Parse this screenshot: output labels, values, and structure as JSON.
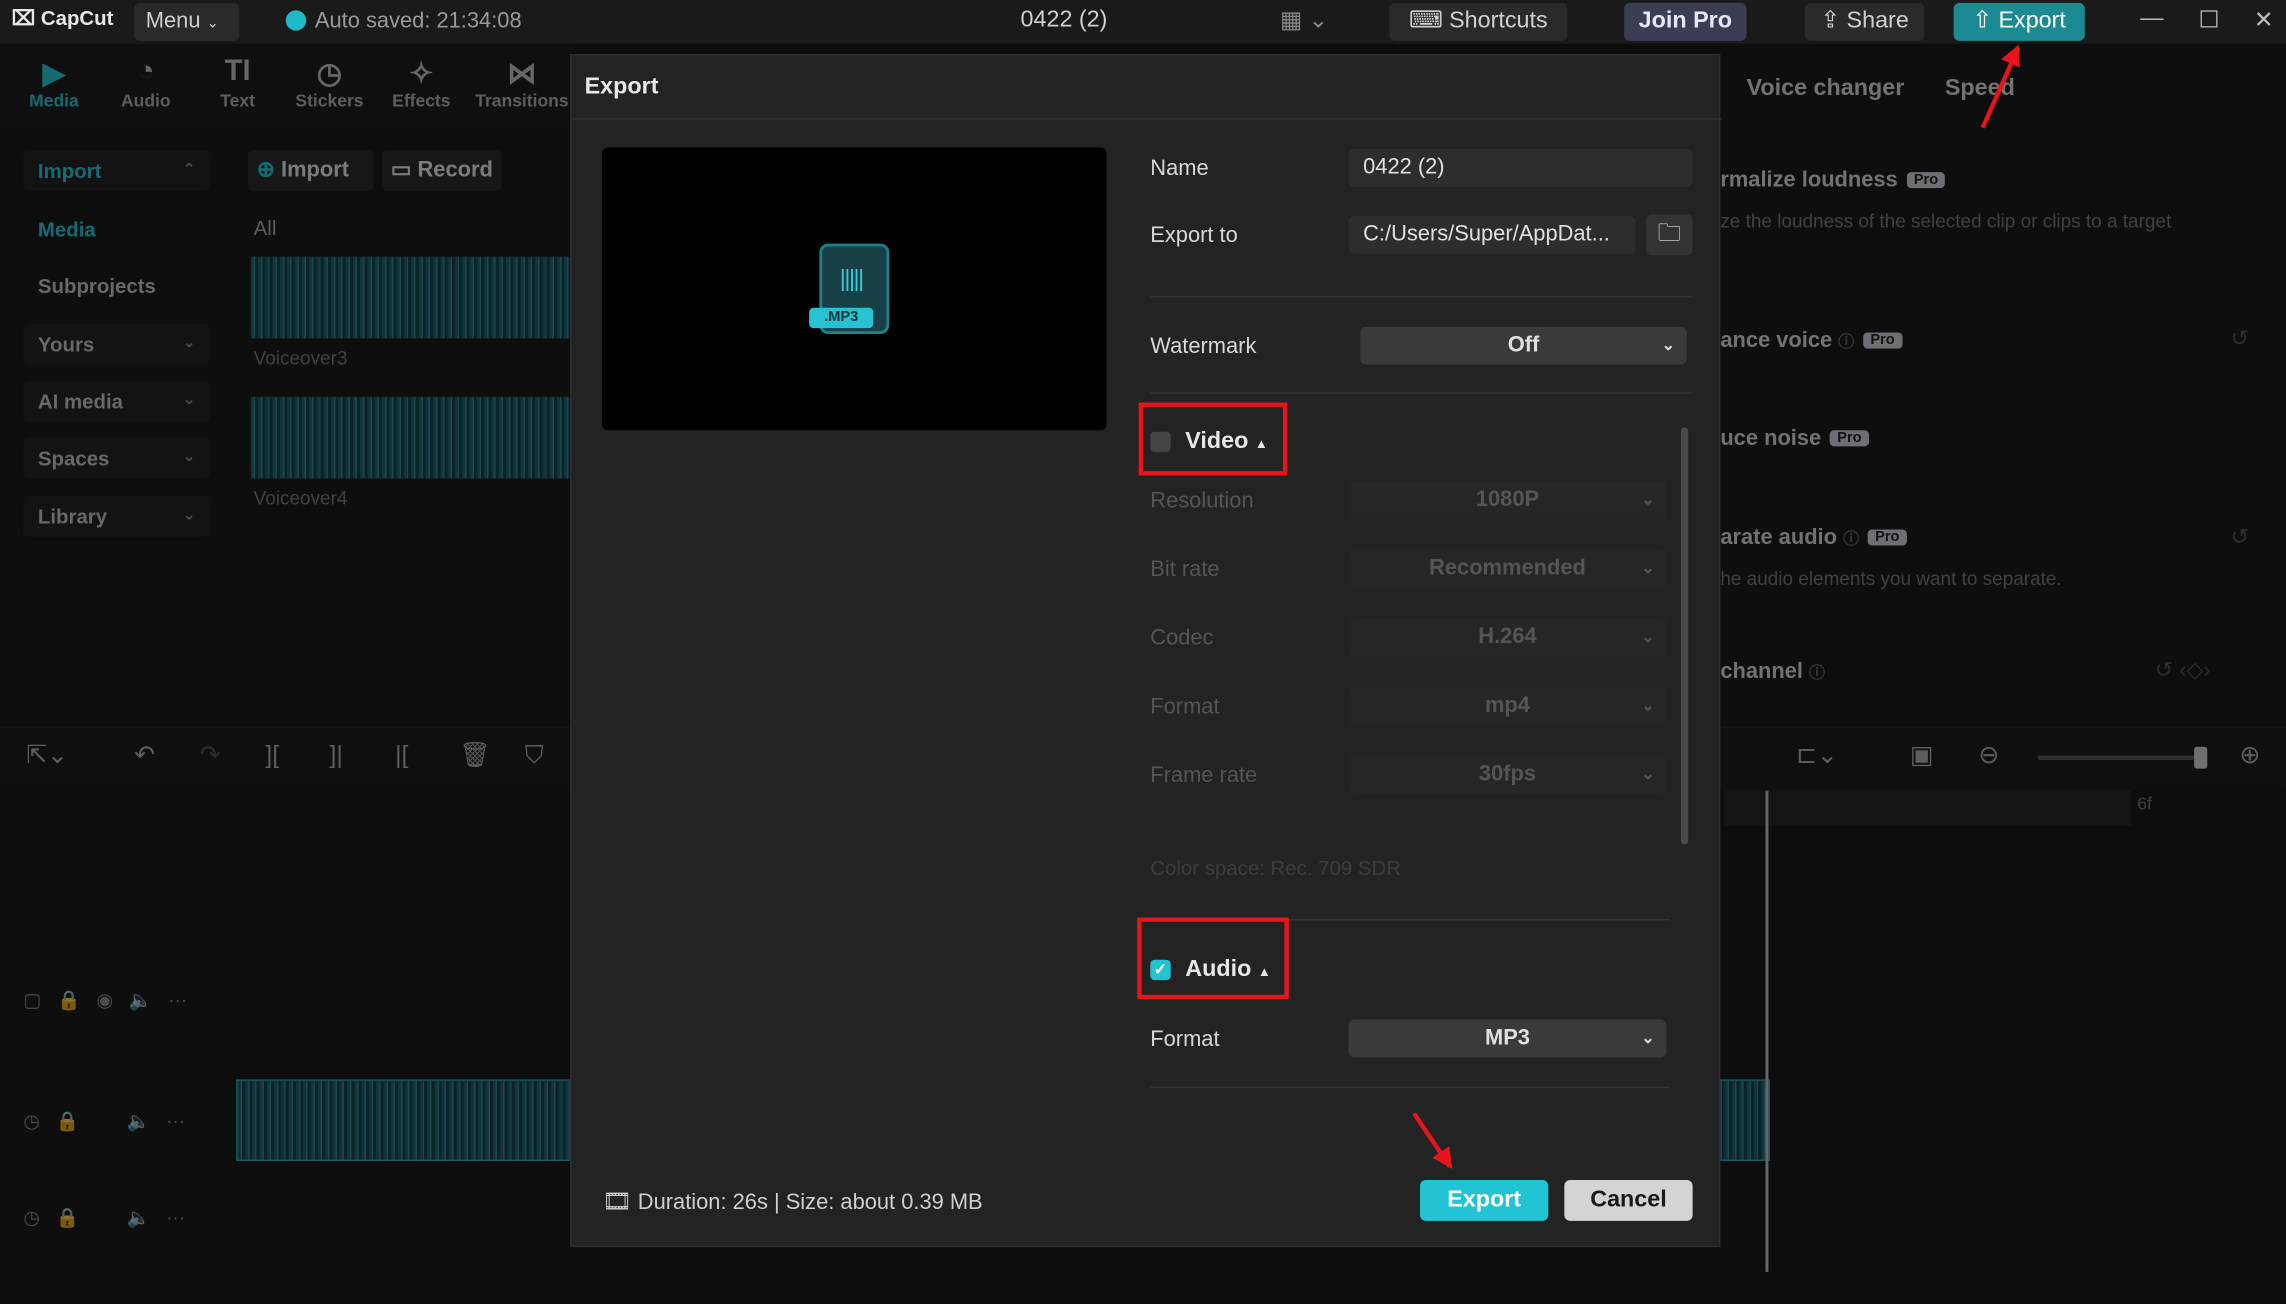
{
  "titlebar": {
    "logo": "CapCut",
    "menu": "Menu",
    "autosave": "Auto saved: 21:34:08",
    "project_title": "0422 (2)",
    "shortcuts": "Shortcuts",
    "join_pro": "Join Pro",
    "share": "Share",
    "export": "Export"
  },
  "toolbar": [
    {
      "label": "Media",
      "icon": "media-icon",
      "glyph": "▶"
    },
    {
      "label": "Audio",
      "icon": "audio-icon",
      "glyph": "◔"
    },
    {
      "label": "Text",
      "icon": "text-icon",
      "glyph": "TI"
    },
    {
      "label": "Stickers",
      "icon": "stickers-icon",
      "glyph": "◷"
    },
    {
      "label": "Effects",
      "icon": "effects-icon",
      "glyph": "✧"
    },
    {
      "label": "Transitions",
      "icon": "transitions-icon",
      "glyph": "⋈"
    }
  ],
  "sidebar": {
    "items": [
      {
        "label": "Import"
      },
      {
        "label": "Media"
      },
      {
        "label": "Subprojects"
      },
      {
        "label": "Yours"
      },
      {
        "label": "AI media"
      },
      {
        "label": "Spaces"
      },
      {
        "label": "Library"
      }
    ]
  },
  "media": {
    "import_btn": "Import",
    "record_btn": "Record",
    "filter": "All",
    "clips": [
      {
        "name": "Voiceover3"
      },
      {
        "name": "Voiceover4"
      }
    ]
  },
  "right_panel": {
    "tabs": [
      "Voice changer",
      "Speed"
    ],
    "normalize_title": "rmalize loudness",
    "normalize_desc": "ze the loudness of the selected clip or clips to a target",
    "enhance": "ance voice",
    "reduce": "uce noise",
    "separate": "arate audio",
    "separate_desc": "he audio elements you want to separate.",
    "channel": "channel",
    "pro": "Pro"
  },
  "timeline": {
    "ruler_end": "6f"
  },
  "export_dialog": {
    "title": "Export",
    "file_badge": ".MP3",
    "name_label": "Name",
    "name_value": "0422 (2)",
    "export_to_label": "Export to",
    "export_to_value": "C:/Users/Super/AppDat...",
    "watermark_label": "Watermark",
    "watermark_value": "Off",
    "video": {
      "label": "Video",
      "checked": false,
      "resolution_label": "Resolution",
      "resolution": "1080P",
      "bitrate_label": "Bit rate",
      "bitrate": "Recommended",
      "codec_label": "Codec",
      "codec": "H.264",
      "format_label": "Format",
      "format": "mp4",
      "framerate_label": "Frame rate",
      "framerate": "30fps",
      "colorspace": "Color space: Rec. 709 SDR"
    },
    "audio": {
      "label": "Audio",
      "checked": true,
      "format_label": "Format",
      "format": "MP3"
    },
    "footer": "Duration: 26s | Size: about 0.39 MB",
    "export_btn": "Export",
    "cancel_btn": "Cancel"
  },
  "colors": {
    "accent": "#22c4d4",
    "highlight": "#e8141c"
  }
}
